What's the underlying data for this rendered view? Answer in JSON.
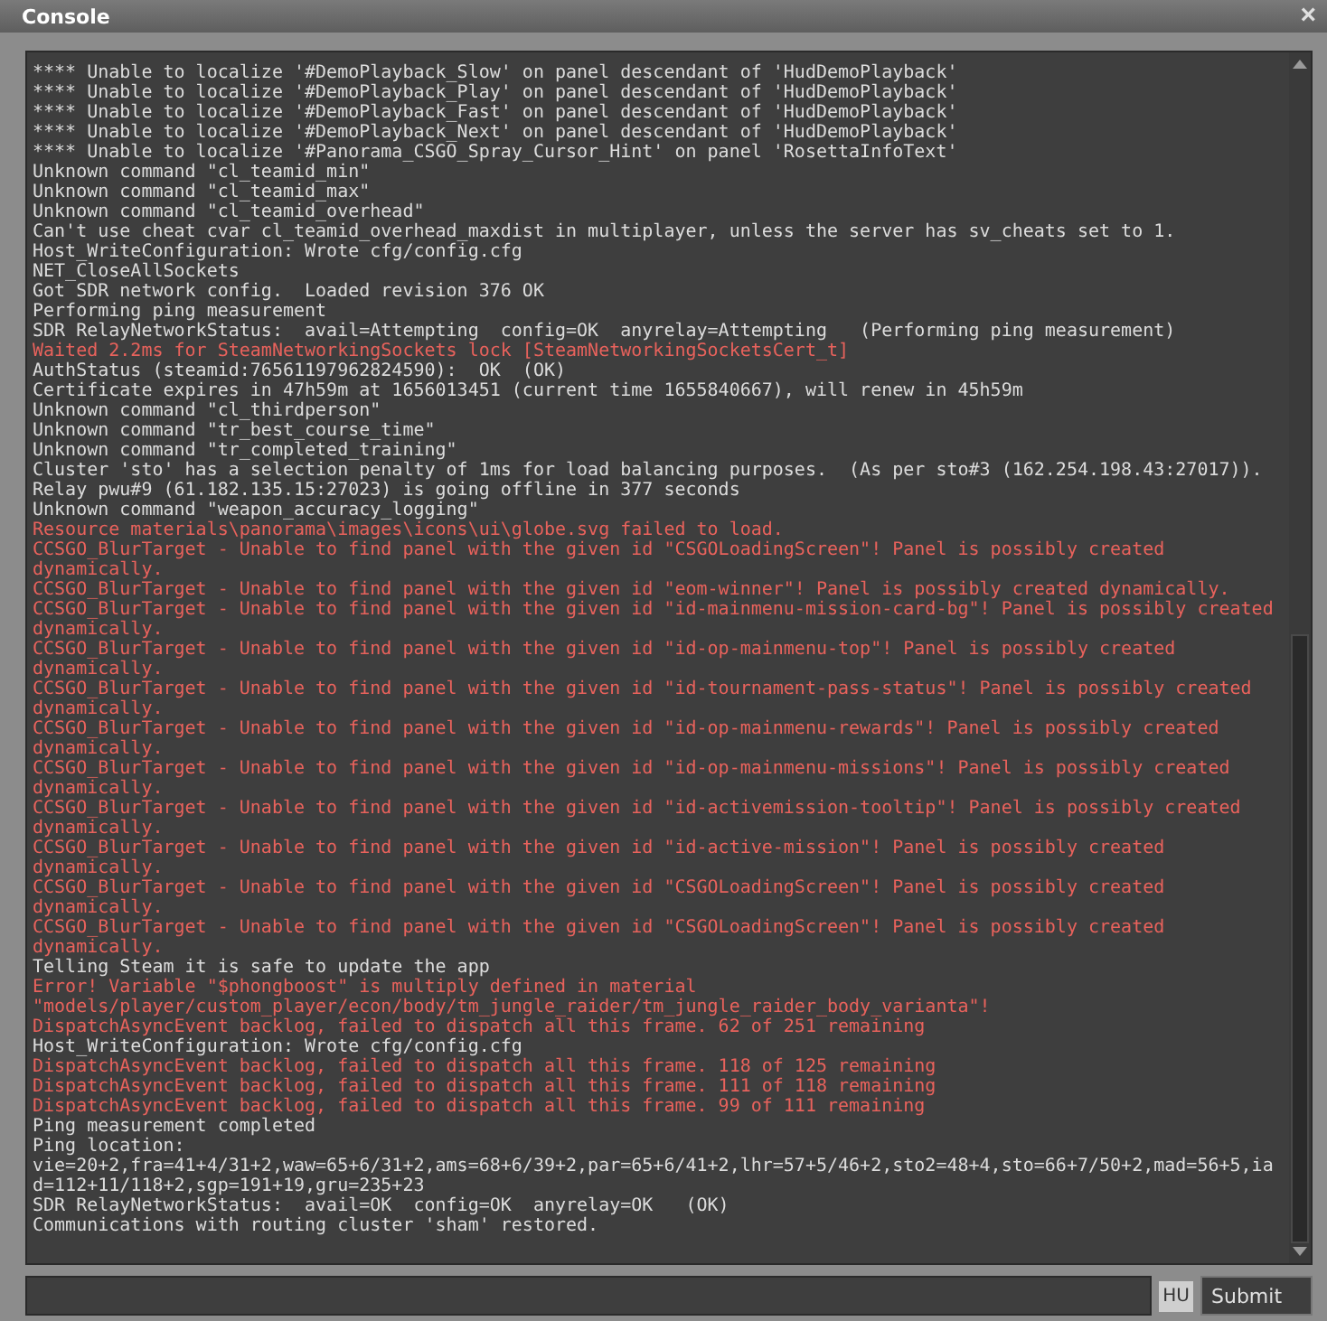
{
  "window": {
    "title": "Console",
    "close": "×"
  },
  "log": [
    {
      "kind": "normal",
      "text": "**** Unable to localize '#DemoPlayback_Slow' on panel descendant of 'HudDemoPlayback'"
    },
    {
      "kind": "normal",
      "text": "**** Unable to localize '#DemoPlayback_Play' on panel descendant of 'HudDemoPlayback'"
    },
    {
      "kind": "normal",
      "text": "**** Unable to localize '#DemoPlayback_Fast' on panel descendant of 'HudDemoPlayback'"
    },
    {
      "kind": "normal",
      "text": "**** Unable to localize '#DemoPlayback_Next' on panel descendant of 'HudDemoPlayback'"
    },
    {
      "kind": "normal",
      "text": "**** Unable to localize '#Panorama_CSGO_Spray_Cursor_Hint' on panel 'RosettaInfoText'"
    },
    {
      "kind": "normal",
      "text": "Unknown command \"cl_teamid_min\""
    },
    {
      "kind": "normal",
      "text": "Unknown command \"cl_teamid_max\""
    },
    {
      "kind": "normal",
      "text": "Unknown command \"cl_teamid_overhead\""
    },
    {
      "kind": "normal",
      "text": "Can't use cheat cvar cl_teamid_overhead_maxdist in multiplayer, unless the server has sv_cheats set to 1."
    },
    {
      "kind": "normal",
      "text": "Host_WriteConfiguration: Wrote cfg/config.cfg"
    },
    {
      "kind": "normal",
      "text": "NET_CloseAllSockets"
    },
    {
      "kind": "normal",
      "text": "Got SDR network config.  Loaded revision 376 OK"
    },
    {
      "kind": "normal",
      "text": "Performing ping measurement"
    },
    {
      "kind": "normal",
      "text": "SDR RelayNetworkStatus:  avail=Attempting  config=OK  anyrelay=Attempting   (Performing ping measurement)"
    },
    {
      "kind": "error",
      "text": "Waited 2.2ms for SteamNetworkingSockets lock [SteamNetworkingSocketsCert_t]"
    },
    {
      "kind": "normal",
      "text": "AuthStatus (steamid:76561197962824590):  OK  (OK)"
    },
    {
      "kind": "normal",
      "text": "Certificate expires in 47h59m at 1656013451 (current time 1655840667), will renew in 45h59m"
    },
    {
      "kind": "normal",
      "text": "Unknown command \"cl_thirdperson\""
    },
    {
      "kind": "normal",
      "text": "Unknown command \"tr_best_course_time\""
    },
    {
      "kind": "normal",
      "text": "Unknown command \"tr_completed_training\""
    },
    {
      "kind": "normal",
      "text": "Cluster 'sto' has a selection penalty of 1ms for load balancing purposes.  (As per sto#3 (162.254.198.43:27017))."
    },
    {
      "kind": "normal",
      "text": "Relay pwu#9 (61.182.135.15:27023) is going offline in 377 seconds"
    },
    {
      "kind": "normal",
      "text": "Unknown command \"weapon_accuracy_logging\""
    },
    {
      "kind": "error",
      "text": "Resource materials\\panorama\\images\\icons\\ui\\globe.svg failed to load."
    },
    {
      "kind": "error",
      "text": "CCSGO_BlurTarget - Unable to find panel with the given id \"CSGOLoadingScreen\"! Panel is possibly created dynamically."
    },
    {
      "kind": "error",
      "text": "CCSGO_BlurTarget - Unable to find panel with the given id \"eom-winner\"! Panel is possibly created dynamically."
    },
    {
      "kind": "error",
      "text": "CCSGO_BlurTarget - Unable to find panel with the given id \"id-mainmenu-mission-card-bg\"! Panel is possibly created dynamically."
    },
    {
      "kind": "error",
      "text": "CCSGO_BlurTarget - Unable to find panel with the given id \"id-op-mainmenu-top\"! Panel is possibly created dynamically."
    },
    {
      "kind": "error",
      "text": "CCSGO_BlurTarget - Unable to find panel with the given id \"id-tournament-pass-status\"! Panel is possibly created dynamically."
    },
    {
      "kind": "error",
      "text": "CCSGO_BlurTarget - Unable to find panel with the given id \"id-op-mainmenu-rewards\"! Panel is possibly created dynamically."
    },
    {
      "kind": "error",
      "text": "CCSGO_BlurTarget - Unable to find panel with the given id \"id-op-mainmenu-missions\"! Panel is possibly created dynamically."
    },
    {
      "kind": "error",
      "text": "CCSGO_BlurTarget - Unable to find panel with the given id \"id-activemission-tooltip\"! Panel is possibly created dynamically."
    },
    {
      "kind": "error",
      "text": "CCSGO_BlurTarget - Unable to find panel with the given id \"id-active-mission\"! Panel is possibly created dynamically."
    },
    {
      "kind": "error",
      "text": "CCSGO_BlurTarget - Unable to find panel with the given id \"CSGOLoadingScreen\"! Panel is possibly created dynamically."
    },
    {
      "kind": "error",
      "text": "CCSGO_BlurTarget - Unable to find panel with the given id \"CSGOLoadingScreen\"! Panel is possibly created dynamically."
    },
    {
      "kind": "normal",
      "text": "Telling Steam it is safe to update the app"
    },
    {
      "kind": "error",
      "text": "Error! Variable \"$phongboost\" is multiply defined in material \"models/player/custom_player/econ/body/tm_jungle_raider/tm_jungle_raider_body_varianta\"!"
    },
    {
      "kind": "error",
      "text": "DispatchAsyncEvent backlog, failed to dispatch all this frame. 62 of 251 remaining"
    },
    {
      "kind": "normal",
      "text": "Host_WriteConfiguration: Wrote cfg/config.cfg"
    },
    {
      "kind": "error",
      "text": "DispatchAsyncEvent backlog, failed to dispatch all this frame. 118 of 125 remaining"
    },
    {
      "kind": "error",
      "text": "DispatchAsyncEvent backlog, failed to dispatch all this frame. 111 of 118 remaining"
    },
    {
      "kind": "error",
      "text": "DispatchAsyncEvent backlog, failed to dispatch all this frame. 99 of 111 remaining"
    },
    {
      "kind": "normal",
      "text": "Ping measurement completed"
    },
    {
      "kind": "normal",
      "text": "Ping location:"
    },
    {
      "kind": "normal",
      "text": "vie=20+2,fra=41+4/31+2,waw=65+6/31+2,ams=68+6/39+2,par=65+6/41+2,lhr=57+5/46+2,sto2=48+4,sto=66+7/50+2,mad=56+5,iad=112+11/118+2,sgp=191+19,gru=235+23"
    },
    {
      "kind": "normal",
      "text": "SDR RelayNetworkStatus:  avail=OK  config=OK  anyrelay=OK   (OK)"
    },
    {
      "kind": "normal",
      "text": "Communications with routing cluster 'sham' restored."
    }
  ],
  "input": {
    "language": "HU",
    "submit": "Submit"
  }
}
